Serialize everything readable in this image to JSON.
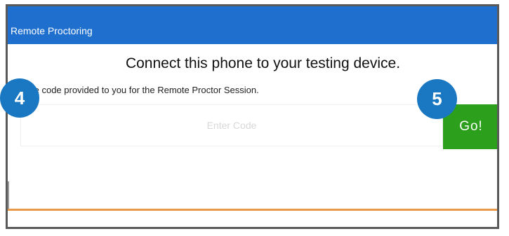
{
  "header": {
    "title": "Remote Proctoring",
    "color": "#1f6fcf"
  },
  "main": {
    "heading": "Connect this phone to your testing device.",
    "instructions": "ter the code provided to you for the Remote Proctor Session.",
    "code_input": {
      "placeholder": "Enter Code",
      "value": ""
    },
    "go_button_label": "Go!",
    "go_button_color": "#2ca01c"
  },
  "annotations": {
    "step_4": "4",
    "step_5": "5",
    "badge_color": "#1a78c2"
  },
  "divider_color": "#e89a4a"
}
